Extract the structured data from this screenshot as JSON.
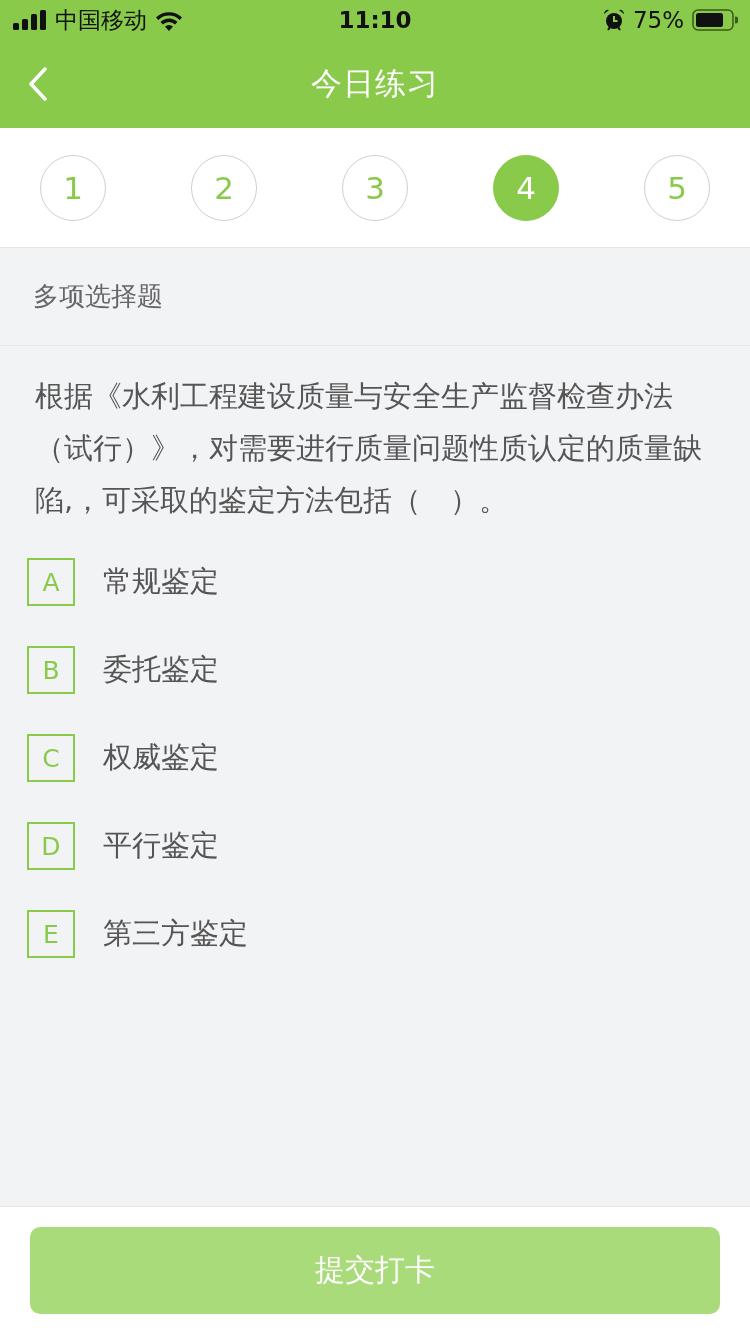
{
  "status_bar": {
    "carrier": "中国移动",
    "time": "11:10",
    "battery": "75%"
  },
  "header": {
    "title": "今日练习"
  },
  "steps": [
    {
      "label": "1",
      "selected": false
    },
    {
      "label": "2",
      "selected": false
    },
    {
      "label": "3",
      "selected": false
    },
    {
      "label": "4",
      "selected": true
    },
    {
      "label": "5",
      "selected": false
    }
  ],
  "question": {
    "type": "多项选择题",
    "text": "根据《水利工程建设质量与安全生产监督检查办法（试行）》，对需要进行质量问题性质认定的质量缺陷,，可采取的鉴定方法包括（　）。"
  },
  "options": [
    {
      "letter": "A",
      "text": "常规鉴定",
      "selected": false
    },
    {
      "letter": "B",
      "text": "委托鉴定",
      "selected": false
    },
    {
      "letter": "C",
      "text": "权威鉴定",
      "selected": false
    },
    {
      "letter": "D",
      "text": "平行鉴定",
      "selected": false
    },
    {
      "letter": "E",
      "text": "第三方鉴定",
      "selected": false
    }
  ],
  "submit_button": {
    "label": "提交打卡",
    "disabled": true
  }
}
